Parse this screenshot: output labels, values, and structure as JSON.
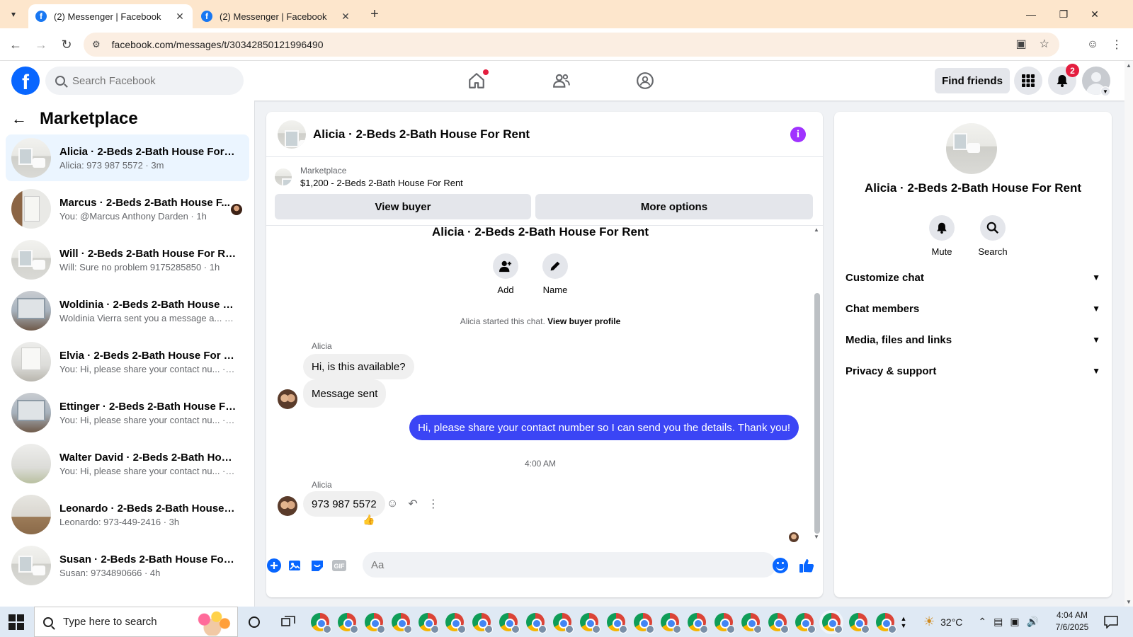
{
  "browser": {
    "tabs": [
      {
        "title": "(2) Messenger | Facebook",
        "active": true
      },
      {
        "title": "(2) Messenger | Facebook",
        "active": false
      }
    ],
    "url": "facebook.com/messages/t/30342850121996490"
  },
  "fb_header": {
    "search_placeholder": "Search Facebook",
    "find_friends": "Find friends",
    "notification_count": "2"
  },
  "sidebar": {
    "title": "Marketplace",
    "conversations": [
      {
        "title": "Alicia · 2-Beds 2-Bath House For R...",
        "subtitle": "Alicia: 973 987 5572 · 3m",
        "thumb": "bath",
        "selected": true
      },
      {
        "title": "Marcus · 2-Beds 2-Bath House F...",
        "subtitle": "You: @Marcus Anthony Darden · 1h",
        "thumb": "room1",
        "selected": false
      },
      {
        "title": "Will · 2-Beds 2-Bath House For Rent",
        "subtitle": "Will: Sure no problem 9175285850 · 1h",
        "thumb": "bath",
        "selected": false
      },
      {
        "title": "Woldinia · 2-Beds 2-Bath House F...",
        "subtitle": "Woldinia Vierra sent you a message a... · 1h",
        "thumb": "kitchen",
        "selected": false
      },
      {
        "title": "Elvia · 2-Beds 2-Bath House For Rent",
        "subtitle": "You: Hi, please share your contact nu... · 2h",
        "thumb": "empty",
        "selected": false
      },
      {
        "title": "Ettinger · 2-Beds 2-Bath House For...",
        "subtitle": "You: Hi, please share your contact nu... · 3h",
        "thumb": "kitchen",
        "selected": false
      },
      {
        "title": "Walter David · 2-Beds 2-Bath Hous...",
        "subtitle": "You: Hi, please share your contact nu... · 3h",
        "thumb": "green",
        "selected": false
      },
      {
        "title": "Leonardo · 2-Beds 2-Bath House F...",
        "subtitle": "Leonardo: 973-449-2416 · 3h",
        "thumb": "wood",
        "selected": false
      },
      {
        "title": "Susan · 2-Beds 2-Bath House For R...",
        "subtitle": "Susan: 9734890666 · 4h",
        "thumb": "bath",
        "selected": false
      }
    ]
  },
  "chat": {
    "title": "Alicia · 2-Beds 2-Bath House For Rent",
    "listing_label": "Marketplace",
    "listing_price": "$1,200 - 2-Beds 2-Bath House For Rent",
    "view_buyer": "View buyer",
    "more_options": "More options",
    "conversation_title": "Alicia · 2-Beds 2-Bath House For Rent",
    "add_label": "Add",
    "name_label": "Name",
    "started_text": "Alicia started this chat.",
    "view_buyer_profile": "View buyer profile",
    "sender_name": "Alicia",
    "msg1": "Hi, is this available?",
    "msg2": "Message sent",
    "msg_out": "Hi, please share your contact number so I can send you the details. Thank you!",
    "timestamp": "4:00 AM",
    "sender_name2": "Alicia",
    "msg3": "973 987 5572",
    "reaction": "👍",
    "composer_placeholder": "Aa"
  },
  "info_panel": {
    "name": "Alicia · 2-Beds 2-Bath House For Rent",
    "mute": "Mute",
    "search": "Search",
    "sections": [
      "Customize chat",
      "Chat members",
      "Media, files and links",
      "Privacy & support"
    ]
  },
  "taskbar": {
    "search_placeholder": "Type here to search",
    "temperature": "32°C",
    "time": "4:04 AM",
    "date": "7/6/2025"
  },
  "colors": {
    "fb_blue": "#0866ff",
    "outgoing_bubble": "#3b45f5",
    "selected_row": "#ebf5ff",
    "tab_strip": "#fde6cc"
  }
}
